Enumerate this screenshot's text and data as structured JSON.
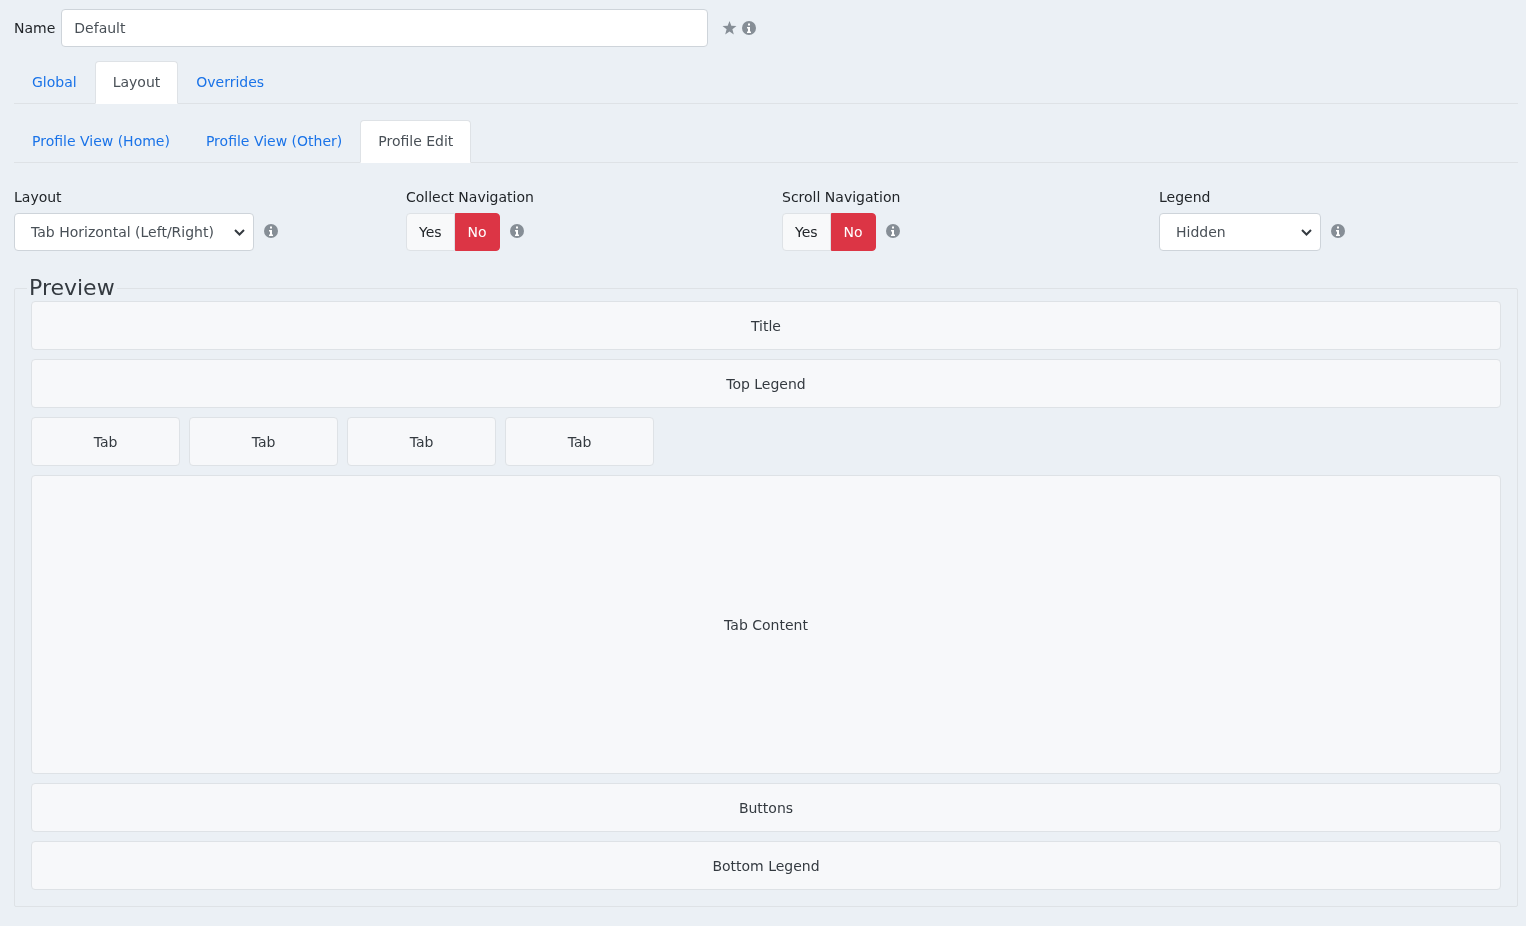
{
  "name_field": {
    "label": "Name",
    "value": "Default"
  },
  "tabs": [
    {
      "label": "Global",
      "selected": false
    },
    {
      "label": "Layout",
      "selected": true
    },
    {
      "label": "Overrides",
      "selected": false
    }
  ],
  "subtabs": [
    {
      "label": "Profile View (Home)",
      "selected": false
    },
    {
      "label": "Profile View (Other)",
      "selected": false
    },
    {
      "label": "Profile Edit",
      "selected": true
    }
  ],
  "settings": [
    {
      "kind": "select",
      "label": "Layout",
      "value": "Tab Horizontal (Left/Right)"
    },
    {
      "kind": "toggle",
      "label": "Collect Navigation",
      "options": [
        {
          "label": "Yes",
          "selected": false
        },
        {
          "label": "No",
          "selected": true
        }
      ]
    },
    {
      "kind": "toggle",
      "label": "Scroll Navigation",
      "options": [
        {
          "label": "Yes",
          "selected": false
        },
        {
          "label": "No",
          "selected": true
        }
      ]
    },
    {
      "kind": "select",
      "label": "Legend",
      "value": "Hidden"
    }
  ],
  "preview": {
    "title": "Preview",
    "blocks": [
      {
        "kind": "bar",
        "label": "Title"
      },
      {
        "kind": "bar",
        "label": "Top Legend"
      },
      {
        "kind": "tabs",
        "tabs": [
          "Tab",
          "Tab",
          "Tab",
          "Tab"
        ]
      },
      {
        "kind": "content",
        "label": "Tab Content"
      },
      {
        "kind": "bar",
        "label": "Buttons"
      },
      {
        "kind": "bar",
        "label": "Bottom Legend"
      }
    ]
  }
}
